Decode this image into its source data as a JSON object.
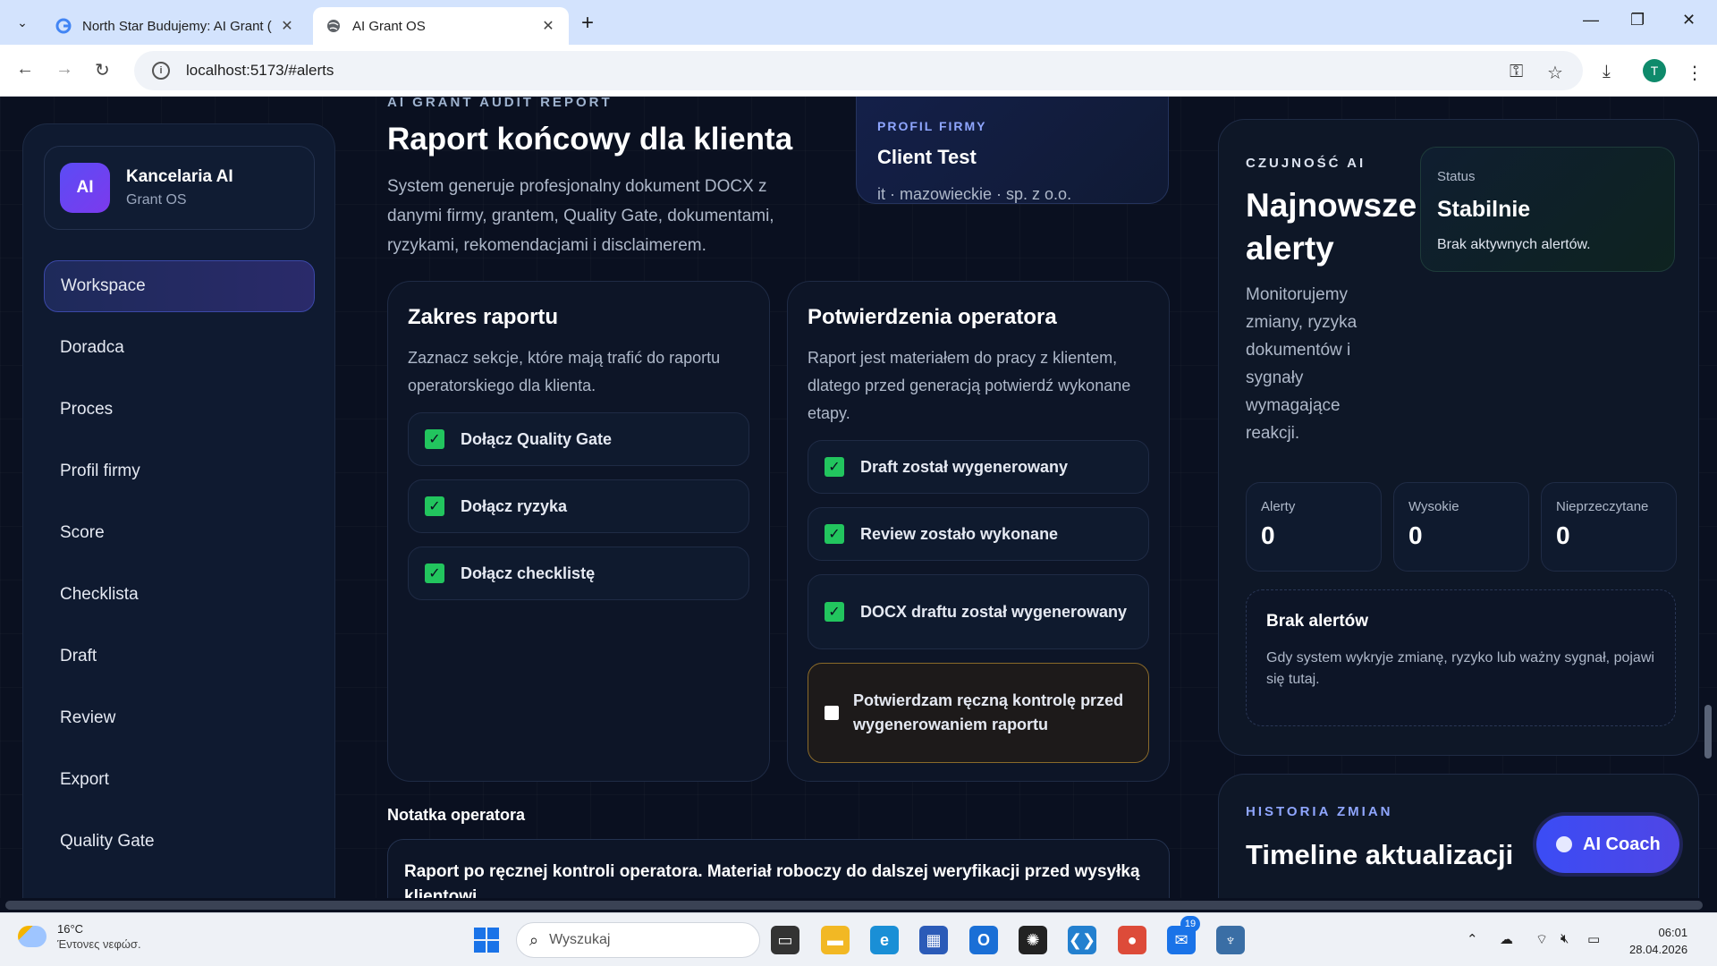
{
  "browser": {
    "tabs": [
      {
        "title": "North Star Budujemy: AI Grant (",
        "close": "✕"
      },
      {
        "title": "AI Grant OS",
        "close": "✕"
      }
    ],
    "new_tab": "+",
    "url": "localhost:5173/#alerts",
    "profile_initial": "T"
  },
  "sidebar": {
    "brand_logo": "AI",
    "brand_name": "Kancelaria AI",
    "brand_sub": "Grant OS",
    "items": [
      {
        "label": "Workspace",
        "active": true
      },
      {
        "label": "Doradca"
      },
      {
        "label": "Proces"
      },
      {
        "label": "Profil firmy"
      },
      {
        "label": "Score"
      },
      {
        "label": "Checklista"
      },
      {
        "label": "Draft"
      },
      {
        "label": "Review"
      },
      {
        "label": "Export"
      },
      {
        "label": "Quality Gate"
      }
    ]
  },
  "header": {
    "kicker": "AI GRANT AUDIT REPORT",
    "title": "Raport końcowy dla klienta",
    "lead": "System generuje profesjonalny dokument DOCX z danymi firmy, grantem, Quality Gate, dokumentami, ryzykami, rekomendacjami i disclaimerem."
  },
  "profile_card": {
    "kicker": "PROFIL FIRMY",
    "name": "Client Test",
    "meta": "it · mazowieckie · sp. z o.o."
  },
  "scope": {
    "title": "Zakres raportu",
    "desc": "Zaznacz sekcje, które mają trafić do raportu operatorskiego dla klienta.",
    "items": [
      {
        "label": "Dołącz Quality Gate",
        "checked": true
      },
      {
        "label": "Dołącz ryzyka",
        "checked": true
      },
      {
        "label": "Dołącz checklistę",
        "checked": true
      }
    ]
  },
  "confirmations": {
    "title": "Potwierdzenia operatora",
    "desc": "Raport jest materiałem do pracy z klientem, dlatego przed generacją potwierdź wykonane etapy.",
    "items": [
      {
        "label": "Draft został wygenerowany",
        "checked": true
      },
      {
        "label": "Review zostało wykonane",
        "checked": true
      },
      {
        "label": "DOCX draftu został wygenerowany",
        "checked": true
      },
      {
        "label": "Potwierdzam ręczną kontrolę przed wygenerowaniem raportu",
        "checked": false
      }
    ]
  },
  "note": {
    "label": "Notatka operatora",
    "text": "Raport po ręcznej kontroli operatora. Materiał roboczy do dalszej weryfikacji przed wysyłką klientowi."
  },
  "alerts": {
    "kicker": "CZUJNOŚĆ AI",
    "title": "Najnowsze alerty",
    "desc": "Monitorujemy zmiany, ryzyka dokumentów i sygnały wymagające reakcji.",
    "status_label": "Status",
    "status_value": "Stabilnie",
    "status_sub": "Brak aktywnych alertów.",
    "stats": [
      {
        "label": "Alerty",
        "value": "0"
      },
      {
        "label": "Wysokie",
        "value": "0"
      },
      {
        "label": "Nieprzeczytane",
        "value": "0"
      }
    ],
    "empty_title": "Brak alertów",
    "empty_desc": "Gdy system wykryje zmianę, ryzyko lub ważny sygnał, pojawi się tutaj."
  },
  "history": {
    "kicker": "HISTORIA ZMIAN",
    "title": "Timeline aktualizacji"
  },
  "coach_label": "AI Coach",
  "taskbar": {
    "weather_temp": "16°C",
    "weather_desc": "Έντονες νεφώσ.",
    "search_placeholder": "Wyszukaj",
    "badge": "19",
    "time": "06:01",
    "date": "28.04.2026"
  },
  "colors": {
    "background": "#0a1020",
    "accent": "#4f46e5",
    "check": "#22c55e",
    "warning_border": "#8a6a2a"
  }
}
